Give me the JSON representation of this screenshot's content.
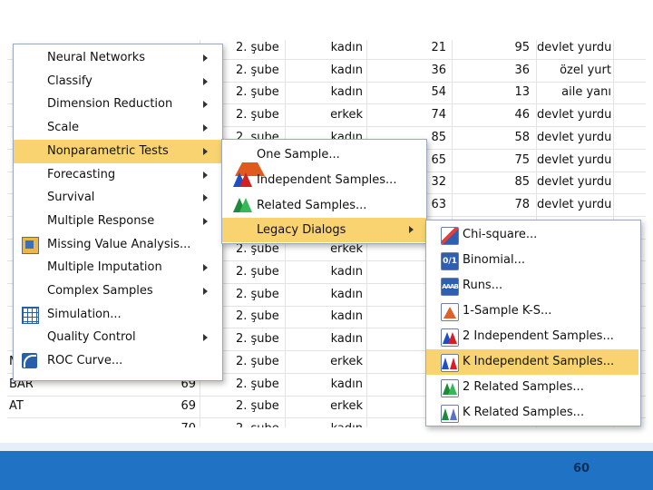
{
  "grid": {
    "rows": [
      {
        "name": "",
        "n": "",
        "sube": "2. şube",
        "gender": "kadın",
        "a": "21",
        "b": "95",
        "place": "devlet yurdu"
      },
      {
        "name": "",
        "n": "",
        "sube": "2. şube",
        "gender": "kadın",
        "a": "36",
        "b": "36",
        "place": "özel yurt"
      },
      {
        "name": "",
        "n": "",
        "sube": "2. şube",
        "gender": "kadın",
        "a": "54",
        "b": "13",
        "place": "aile yanı"
      },
      {
        "name": "",
        "n": "",
        "sube": "2. şube",
        "gender": "erkek",
        "a": "74",
        "b": "46",
        "place": "devlet yurdu"
      },
      {
        "name": "",
        "n": "",
        "sube": "2. şube",
        "gender": "kadın",
        "a": "85",
        "b": "58",
        "place": "devlet yurdu"
      },
      {
        "name": "",
        "n": "",
        "sube": "",
        "gender": "",
        "a": "65",
        "b": "75",
        "place": "devlet yurdu"
      },
      {
        "name": "",
        "n": "",
        "sube": "",
        "gender": "",
        "a": "32",
        "b": "85",
        "place": "devlet yurdu"
      },
      {
        "name": "",
        "n": "",
        "sube": "",
        "gender": "",
        "a": "63",
        "b": "78",
        "place": "devlet yurdu"
      },
      {
        "name": "",
        "n": "",
        "sube": "",
        "gender": "",
        "a": "",
        "b": "",
        "place": ""
      },
      {
        "name": "",
        "n": "",
        "sube": "2. şube",
        "gender": "erkek",
        "a": "",
        "b": "",
        "place": ""
      },
      {
        "name": "",
        "n": "",
        "sube": "2. şube",
        "gender": "kadın",
        "a": "",
        "b": "",
        "place": ""
      },
      {
        "name": "",
        "n": "",
        "sube": "2. şube",
        "gender": "kadın",
        "a": "",
        "b": "",
        "place": ""
      },
      {
        "name": "",
        "n": "",
        "sube": "2. şube",
        "gender": "kadın",
        "a": "",
        "b": "",
        "place": ""
      },
      {
        "name": "",
        "n": "",
        "sube": "2. şube",
        "gender": "kadın",
        "a": "",
        "b": "",
        "place": ""
      },
      {
        "name": "MAZ",
        "n": "69",
        "sube": "2. şube",
        "gender": "erkek",
        "a": "",
        "b": "",
        "place": ""
      },
      {
        "name": "BAR",
        "n": "69",
        "sube": "2. şube",
        "gender": "kadın",
        "a": "",
        "b": "",
        "place": ""
      },
      {
        "name": "AT",
        "n": "69",
        "sube": "2. şube",
        "gender": "erkek",
        "a": "",
        "b": "",
        "place": ""
      },
      {
        "name": "",
        "n": "70",
        "sube": "2. şube",
        "gender": "kadın",
        "a": "",
        "b": "",
        "place": ""
      }
    ]
  },
  "analyze_menu": {
    "items": [
      {
        "label": "Neural Networks",
        "submenu": true,
        "icon": ""
      },
      {
        "label": "Classify",
        "submenu": true,
        "icon": ""
      },
      {
        "label": "Dimension Reduction",
        "submenu": true,
        "icon": ""
      },
      {
        "label": "Scale",
        "submenu": true,
        "icon": ""
      },
      {
        "label": "Nonparametric Tests",
        "submenu": true,
        "icon": "",
        "highlighted": true
      },
      {
        "label": "Forecasting",
        "submenu": true,
        "icon": ""
      },
      {
        "label": "Survival",
        "submenu": true,
        "icon": ""
      },
      {
        "label": "Multiple Response",
        "submenu": true,
        "icon": ""
      },
      {
        "label": "Missing Value Analysis...",
        "submenu": false,
        "icon": "missing-value-icon"
      },
      {
        "label": "Multiple Imputation",
        "submenu": true,
        "icon": ""
      },
      {
        "label": "Complex Samples",
        "submenu": true,
        "icon": ""
      },
      {
        "label": "Simulation...",
        "submenu": false,
        "icon": "simulation-icon"
      },
      {
        "label": "Quality Control",
        "submenu": true,
        "icon": ""
      },
      {
        "label": "ROC Curve...",
        "submenu": false,
        "icon": "roc-curve-icon"
      }
    ]
  },
  "nonparametric_menu": {
    "items": [
      {
        "label": "One Sample...",
        "icon": "one-sample-icon"
      },
      {
        "label": "Independent Samples...",
        "icon": "independent-samples-icon"
      },
      {
        "label": "Related Samples...",
        "icon": "related-samples-icon"
      },
      {
        "label": "Legacy Dialogs",
        "icon": "",
        "submenu": true,
        "highlighted": true
      }
    ]
  },
  "legacy_menu": {
    "items": [
      {
        "label": "Chi-square...",
        "icon": "chi-square-icon"
      },
      {
        "label": "Binomial...",
        "icon": "binomial-icon",
        "icon_text": "0/1"
      },
      {
        "label": "Runs...",
        "icon": "runs-icon",
        "icon_text": "AAAB"
      },
      {
        "label": "1-Sample K-S...",
        "icon": "one-sample-ks-icon"
      },
      {
        "label": "2 Independent Samples...",
        "icon": "two-independent-samples-icon"
      },
      {
        "label": "K Independent Samples...",
        "icon": "k-independent-samples-icon",
        "highlighted": true
      },
      {
        "label": "2 Related Samples...",
        "icon": "two-related-samples-icon"
      },
      {
        "label": "K Related Samples...",
        "icon": "k-related-samples-icon"
      }
    ]
  },
  "footer": {
    "page_number": "60"
  },
  "colors": {
    "highlight": "#f9d36f",
    "footer": "#1f72c4",
    "menu_border": "#9aa9bd"
  }
}
